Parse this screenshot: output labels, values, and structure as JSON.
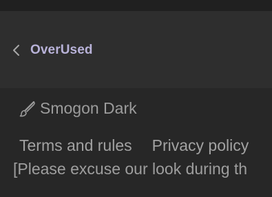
{
  "breadcrumb": {
    "back_label": "OverUsed"
  },
  "footer": {
    "style_chooser_label": "Smogon Dark",
    "links": [
      {
        "label": "Terms and rules"
      },
      {
        "label": "Privacy policy"
      }
    ],
    "notice_text": "[Please excuse our look during th"
  },
  "colors": {
    "page_background": "#272727",
    "breadcrumb_background": "#2e2e2e",
    "top_strip": "#202020",
    "accent_link": "#b8b2d8",
    "footer_text": "#a2a2a2"
  },
  "icons": [
    "chevron-left-icon",
    "paint-brush-icon"
  ]
}
